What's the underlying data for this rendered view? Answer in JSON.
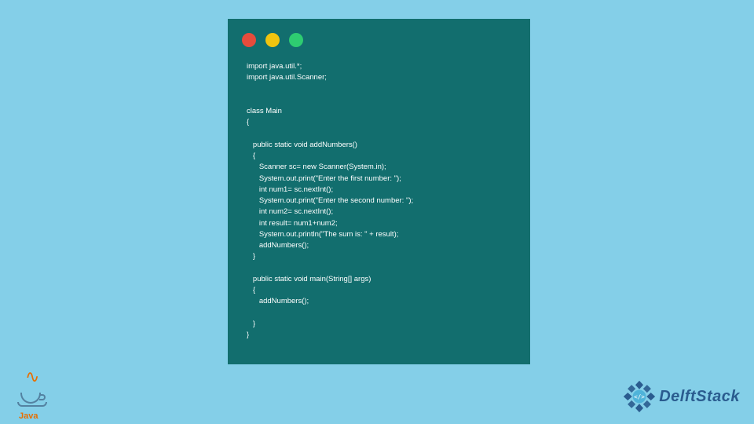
{
  "code_window": {
    "controls": {
      "red": "#e74c3c",
      "yellow": "#f1c40f",
      "green": "#2ecc71"
    },
    "code": "import java.util.*;\nimport java.util.Scanner;\n\n\nclass Main\n{\n\n   public static void addNumbers()\n   {\n      Scanner sc= new Scanner(System.in);\n      System.out.print(\"Enter the first number: \");\n      int num1= sc.nextInt();\n      System.out.print(\"Enter the second number: \");\n      int num2= sc.nextInt();\n      int result= num1+num2;\n      System.out.println(\"The sum is: \" + result);\n      addNumbers();\n   }\n\n   public static void main(String[] args)\n   {\n      addNumbers();\n\n   }\n}"
  },
  "logos": {
    "java_label": "Java",
    "delft_label": "DelftStack"
  }
}
